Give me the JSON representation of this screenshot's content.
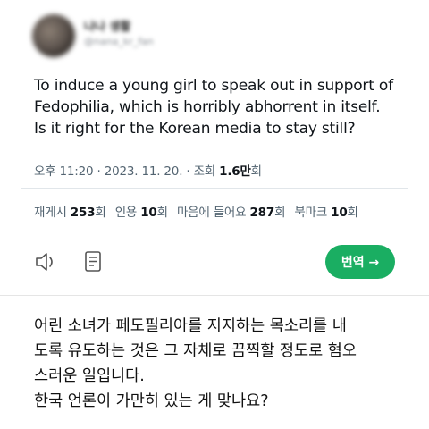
{
  "user": {
    "name": "나나 생활",
    "handle": "@nana_kr_fan"
  },
  "tweet": {
    "lines": [
      "To induce a young girl to speak out in support of",
      "Fedophilia, which is horribly abhorrent in itself.",
      "Is it right for the Korean media to stay still?"
    ]
  },
  "meta": {
    "time": "오후 11:20",
    "sep": " · ",
    "date": "2023. 11. 20.",
    "views_label": "조회",
    "views_value": "1.6만",
    "views_unit": "회"
  },
  "stats": [
    {
      "label": "재게시",
      "value": "253",
      "unit": "회"
    },
    {
      "label": "인용",
      "value": "10",
      "unit": "회"
    },
    {
      "label": "마음에 들어요",
      "value": "287",
      "unit": "회"
    },
    {
      "label": "북마크",
      "value": "10",
      "unit": "회"
    }
  ],
  "actions": {
    "translate_label": "번역 →",
    "icons": [
      "speaker-icon",
      "document-icon"
    ]
  },
  "translation": {
    "lines": [
      "어린 소녀가 페도필리아를 지지하는 목소리를 내",
      "도록 유도하는 것은 그 자체로 끔찍할 정도로 혐오",
      "스러운 일입니다.",
      "한국 언론이 가만히 있는 게 맞나요?"
    ]
  }
}
